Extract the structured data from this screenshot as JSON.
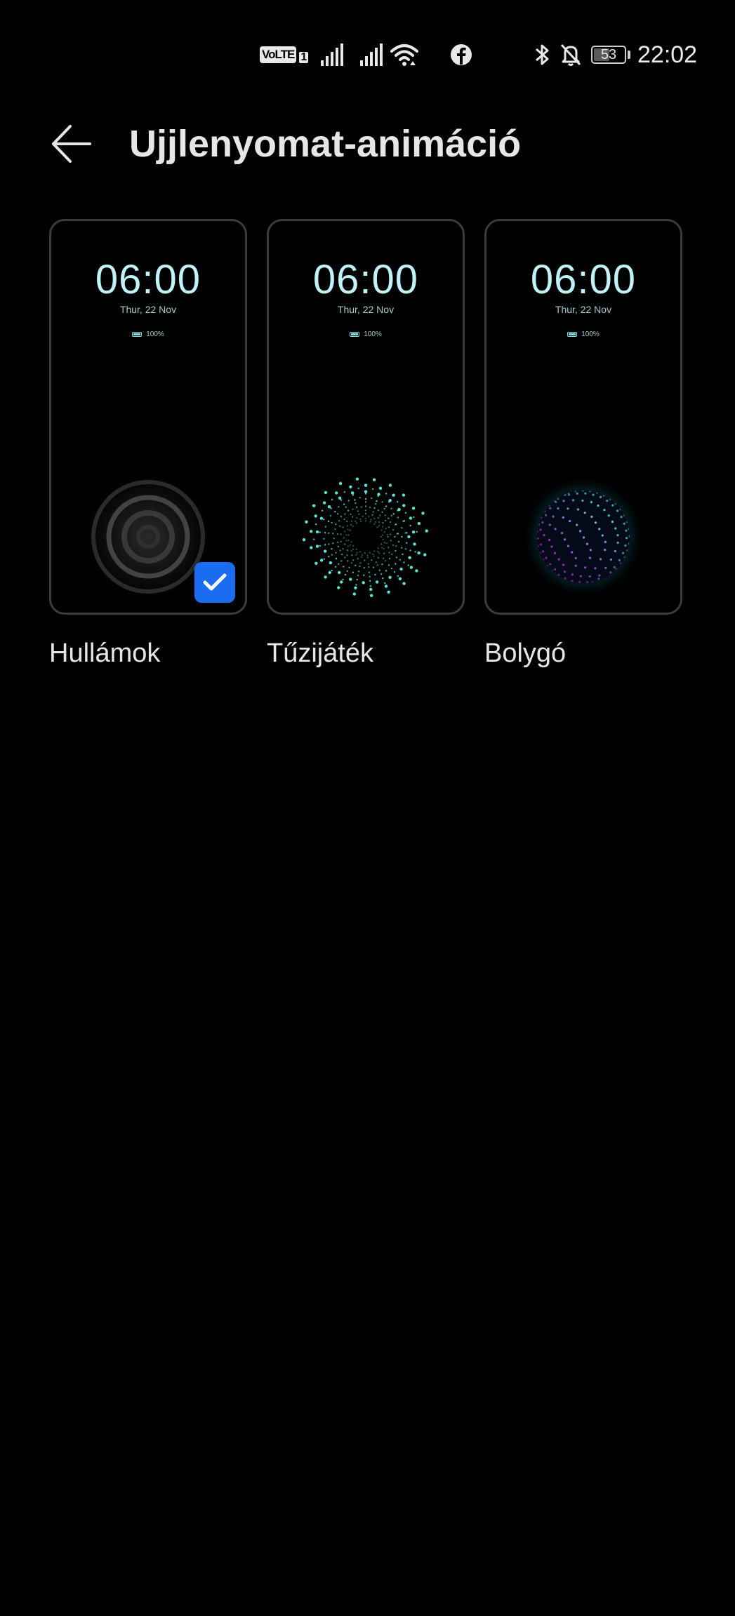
{
  "status_bar": {
    "volte_label": "VoLTE",
    "volte_sim": "1",
    "battery_level": "53",
    "battery_percent": 53,
    "time": "22:02",
    "icons": [
      "volte-icon",
      "signal-icon",
      "signal-icon",
      "wifi-icon",
      "facebook-icon",
      "bluetooth-icon",
      "bell-off-icon",
      "battery-icon"
    ]
  },
  "header": {
    "back_icon": "back-arrow-icon",
    "title": "Ujjlenyomat-animáció"
  },
  "options": [
    {
      "label": "Hullámok",
      "preview_time": "06:00",
      "preview_date": "Thur, 22 Nov",
      "preview_battery": "100%",
      "animation": "waves",
      "selected": true
    },
    {
      "label": "Tűzijáték",
      "preview_time": "06:00",
      "preview_date": "Thur, 22 Nov",
      "preview_battery": "100%",
      "animation": "fireworks",
      "selected": false
    },
    {
      "label": "Bolygó",
      "preview_time": "06:00",
      "preview_date": "Thur, 22 Nov",
      "preview_battery": "100%",
      "animation": "planet",
      "selected": false
    }
  ],
  "colors": {
    "background": "#000000",
    "accent": "#1a6cf0",
    "aod_text": "#bff3f8",
    "firework": "#5ff0e8",
    "planet_cyan": "#3ff6f0",
    "planet_magenta": "#c42bd8"
  }
}
